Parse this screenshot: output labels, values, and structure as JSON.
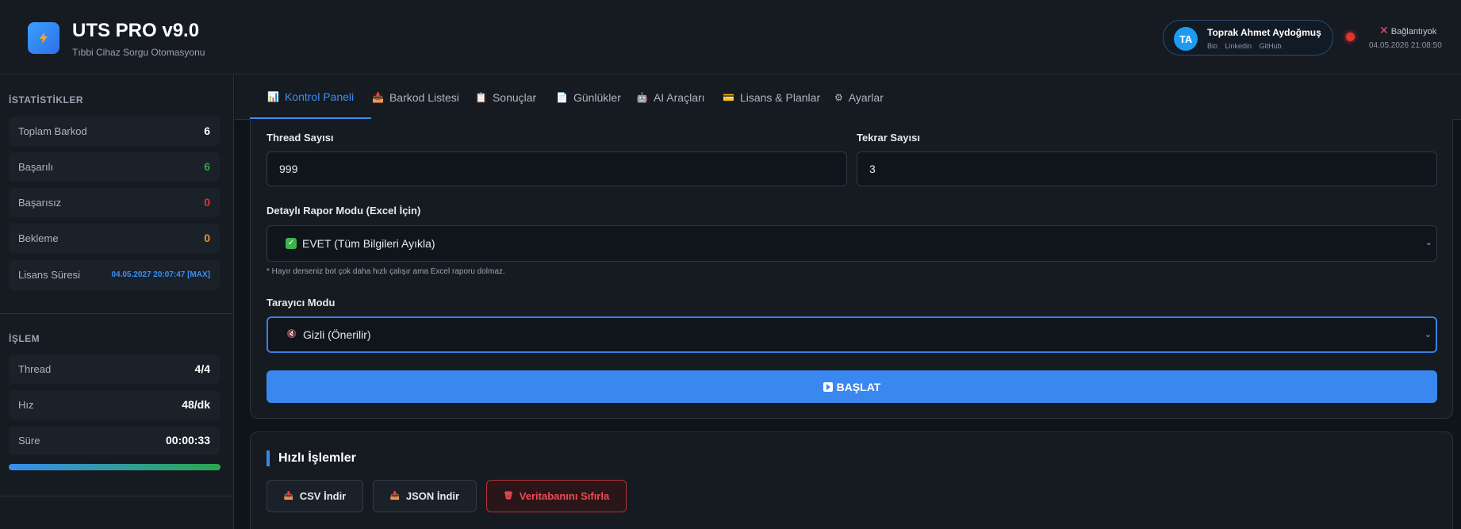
{
  "header": {
    "title": "UTS PRO v9.0",
    "subtitle": "Tıbbi Cihaz Sorgu Otomasyonu",
    "user": {
      "initials": "TA",
      "name": "Toprak Ahmet Aydoğmuş",
      "links": [
        "Bio",
        "Linkedin",
        "GitHub"
      ]
    },
    "connection_status": "Bağlantıyok",
    "timestamp": "04.05.2026 21:08:50",
    "status_color": "#e5322d"
  },
  "sidebar": {
    "stats_title": "İSTATİSTİKLER",
    "stats": [
      {
        "label": "Toplam Barkod",
        "value": "6",
        "color": "#ffffff"
      },
      {
        "label": "Başarılı",
        "value": "6",
        "color": "#2ea44f"
      },
      {
        "label": "Başarısız",
        "value": "0",
        "color": "#e5322d"
      },
      {
        "label": "Bekleme",
        "value": "0",
        "color": "#f0922b"
      }
    ],
    "license": {
      "label": "Lisans Süresi",
      "value": "04.05.2027 20:07:47 [MAX]",
      "color": "#3b8ff5"
    },
    "process_title": "İŞLEM",
    "process": [
      {
        "label": "Thread",
        "value": "4/4"
      },
      {
        "label": "Hız",
        "value": "48/dk"
      },
      {
        "label": "Süre",
        "value": "00:00:33"
      }
    ],
    "progress_percent": 100
  },
  "tabs": [
    {
      "label": "Kontrol Paneli",
      "icon": "chart-icon",
      "active": true
    },
    {
      "label": "Barkod Listesi",
      "icon": "inbox-icon",
      "active": false
    },
    {
      "label": "Sonuçlar",
      "icon": "document-icon",
      "active": false
    },
    {
      "label": "Günlükler",
      "icon": "log-icon",
      "active": false
    },
    {
      "label": "AI Araçları",
      "icon": "robot-icon",
      "active": false
    },
    {
      "label": "Lisans & Planlar",
      "icon": "card-icon",
      "active": false
    },
    {
      "label": "Ayarlar",
      "icon": "gear-icon",
      "active": false
    }
  ],
  "form": {
    "thread_label": "Thread Sayısı",
    "thread_value": "999",
    "repeat_label": "Tekrar Sayısı",
    "repeat_value": "3",
    "report_label": "Detaylı Rapor Modu (Excel İçin)",
    "report_value": "EVET (Tüm Bilgileri Ayıkla)",
    "report_hint": "* Hayır derseniz bot çok daha hızlı çalışır ama Excel raporu dolmaz.",
    "browser_label": "Tarayıcı Modu",
    "browser_value": "Gizli (Önerilir)",
    "start_label": "BAŞLAT"
  },
  "quick_actions": {
    "title": "Hızlı İşlemler",
    "csv_label": "CSV İndir",
    "json_label": "JSON İndir",
    "reset_label": "Veritabanını Sıfırla"
  }
}
